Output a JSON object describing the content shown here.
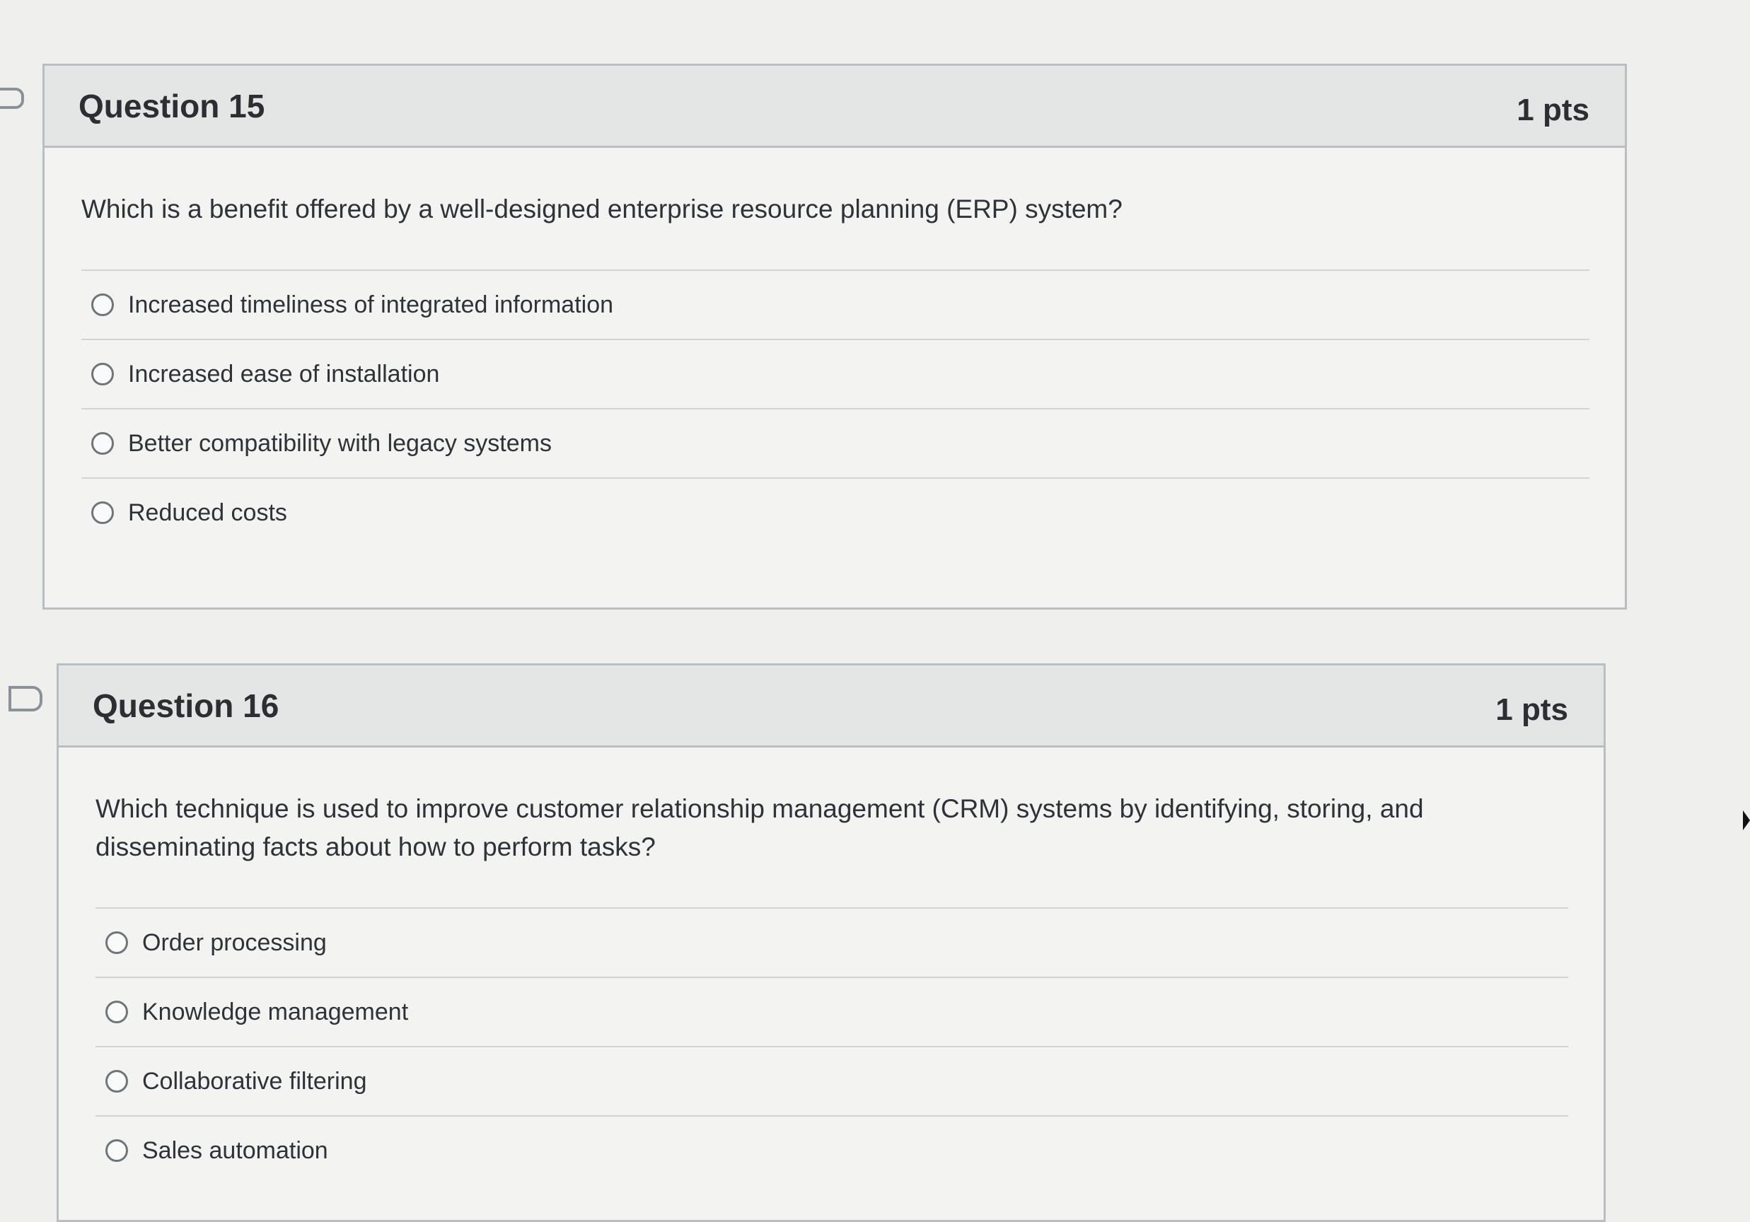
{
  "questions": [
    {
      "title": "Question 15",
      "points": "1 pts",
      "text": "Which is a benefit offered by a well-designed enterprise resource planning (ERP) system?",
      "answers": [
        "Increased timeliness of integrated information",
        "Increased ease of installation",
        "Better compatibility with legacy systems",
        "Reduced costs"
      ]
    },
    {
      "title": "Question 16",
      "points": "1 pts",
      "text": "Which technique is used to improve customer relationship management (CRM) systems by identifying, storing, and disseminating facts about how to perform tasks?",
      "answers": [
        "Order processing",
        "Knowledge management",
        "Collaborative filtering",
        "Sales automation"
      ]
    }
  ]
}
